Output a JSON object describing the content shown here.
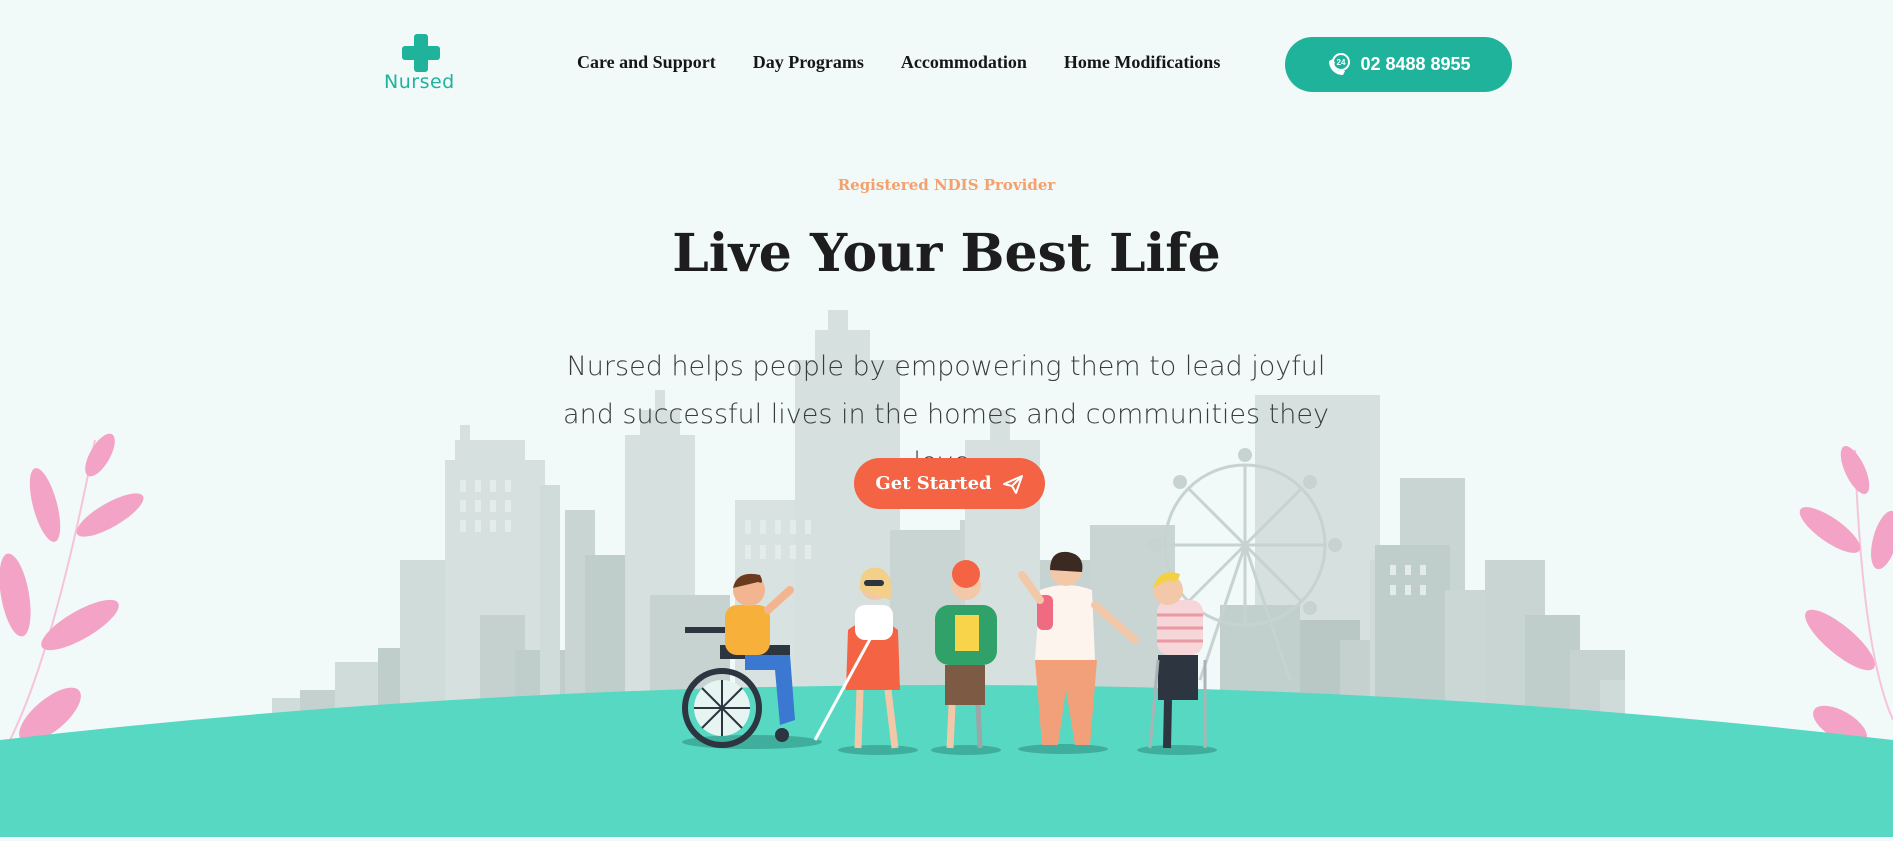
{
  "brand": {
    "name": "Nursed",
    "color": "#1fb39c"
  },
  "nav": {
    "items": [
      {
        "label": "Care and Support"
      },
      {
        "label": "Day Programs"
      },
      {
        "label": "Accommodation"
      },
      {
        "label": "Home Modifications"
      }
    ],
    "phone_badge": "24",
    "phone_label": "02 8488 8955",
    "phone_icon": "phone-24h-icon"
  },
  "hero": {
    "eyebrow": "Registered NDIS Provider",
    "title": "Live Your Best Life",
    "subtitle": "Nursed helps people by empowering them to lead joyful and successful lives in the homes and communities they love.",
    "cta_label": "Get Started",
    "cta_icon": "paper-plane-icon"
  },
  "colors": {
    "accent": "#20b39b",
    "cta": "#f46344",
    "eyebrow": "#f3a16d",
    "ground": "#56d8c3",
    "background": "#f1f9f9"
  }
}
